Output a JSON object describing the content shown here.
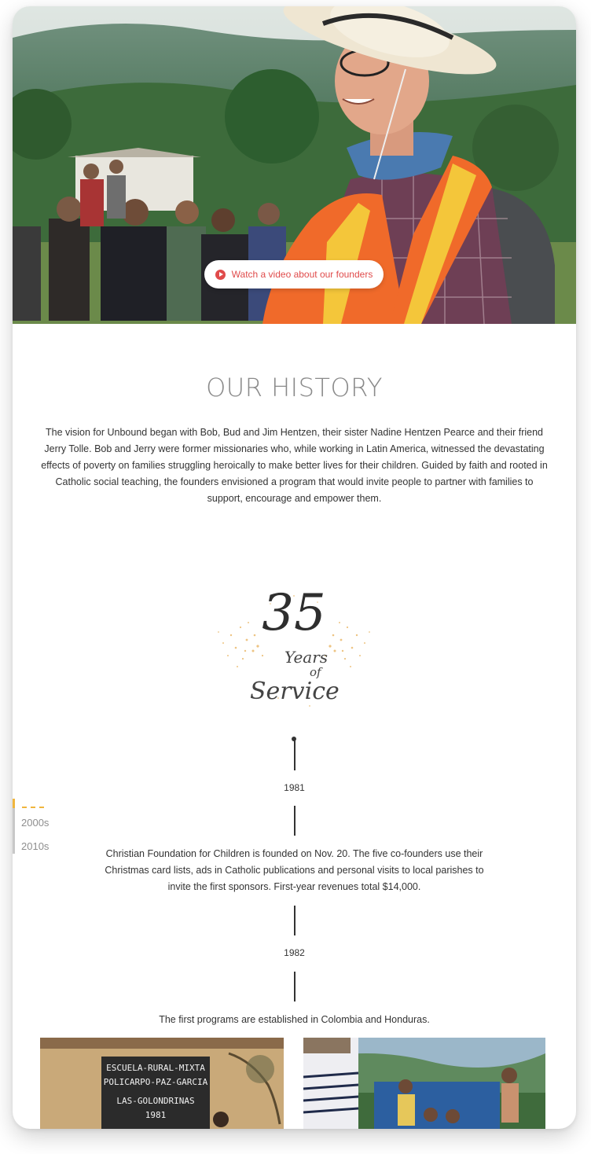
{
  "hero": {
    "video_button_label": "Watch a video about our founders"
  },
  "history": {
    "title": "OUR HISTORY",
    "intro": "The vision for Unbound began with Bob, Bud and Jim Hentzen, their sister Nadine Hentzen Pearce and their friend Jerry Tolle. Bob and Jerry were former missionaries who, while working in Latin America, witnessed the devastating effects of poverty on families struggling heroically to make better lives for their children. Guided by faith and rooted in Catholic social teaching, the founders envisioned a program that would invite people to partner with families to support, encourage and empower them."
  },
  "badge": {
    "number": "35",
    "years": "Years",
    "of": "of",
    "service": "Service"
  },
  "decade_nav": {
    "items": [
      "2000s",
      "2010s"
    ],
    "active_color": "#f0b53d"
  },
  "timeline": [
    {
      "year": "1981",
      "text": "Christian Foundation for Children is founded on Nov. 20. The five co-founders use their Christmas card lists, ads in Catholic publications and personal visits to local parishes to invite the first sponsors. First-year revenues total $14,000."
    },
    {
      "year": "1982",
      "text": "The first programs are established in Colombia and Honduras."
    }
  ],
  "photos": {
    "sign_line1": "ESCUELA-RURAL-MIXTA",
    "sign_line2": "POLICARPO-PAZ-GARCIA",
    "sign_line3": "LAS-GOLONDRINAS",
    "sign_line4": "1981"
  },
  "colors": {
    "accent_red": "#e04b4b",
    "accent_gold": "#f0b53d",
    "title_gray": "#8a8a8a"
  }
}
